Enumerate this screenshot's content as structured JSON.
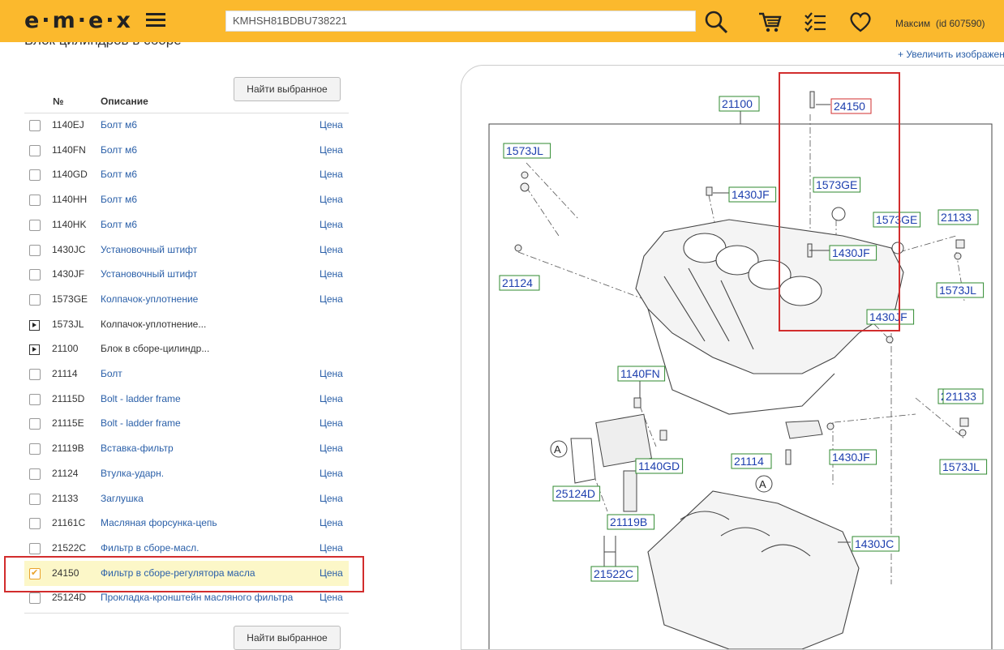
{
  "header": {
    "logo": "e·m·e·x",
    "search_value": "KMHSH81BDBU738221",
    "user_label": "Максим",
    "user_id": "(id 607590)"
  },
  "page": {
    "title": "Блок цилиндров в сборе",
    "zoom_link": "+ Увеличить изображен",
    "find_selected": "Найти выбранное"
  },
  "table": {
    "col_num": "№",
    "col_desc": "Описание",
    "price_label": "Цена",
    "rows": [
      {
        "num": "1140EJ",
        "desc": "Болт м6"
      },
      {
        "num": "1140FN",
        "desc": "Болт м6"
      },
      {
        "num": "1140GD",
        "desc": "Болт м6"
      },
      {
        "num": "1140HH",
        "desc": "Болт м6"
      },
      {
        "num": "1140HK",
        "desc": "Болт м6"
      },
      {
        "num": "1430JC",
        "desc": "Установочный штифт"
      },
      {
        "num": "1430JF",
        "desc": "Установочный штифт"
      },
      {
        "num": "1573GE",
        "desc": "Колпачок-уплотнение"
      },
      {
        "num": "1573JL",
        "desc": "Колпачок-уплотнение..."
      },
      {
        "num": "21100",
        "desc": "Блок в сборе-цилиндр..."
      },
      {
        "num": "21114",
        "desc": "Болт"
      },
      {
        "num": "21115D",
        "desc": "Bolt - ladder frame"
      },
      {
        "num": "21115E",
        "desc": "Bolt - ladder frame"
      },
      {
        "num": "21119B",
        "desc": "Вставка-фильтр"
      },
      {
        "num": "21124",
        "desc": "Втулка-ударн."
      },
      {
        "num": "21133",
        "desc": "Заглушка"
      },
      {
        "num": "21161C",
        "desc": "Масляная форсунка-цепь"
      },
      {
        "num": "21522C",
        "desc": "Фильтр в сборе-масл."
      },
      {
        "num": "24150",
        "desc": "Фильтр в сборе-регулятора масла"
      },
      {
        "num": "25124D",
        "desc": "Прокладка-кронштейн масляного фильтра"
      }
    ]
  },
  "diagram": {
    "labels": [
      "21100",
      "24150",
      "1573JL",
      "1573GE",
      "1573GE",
      "21133",
      "21133",
      "1430JF",
      "1430JF",
      "1430JF",
      "1430JF",
      "21124",
      "1573JL",
      "1140FN",
      "21133",
      "1573JL",
      "1140GD",
      "21114",
      "25124D",
      "21119B",
      "21522C",
      "1430JC",
      "A",
      "A"
    ]
  }
}
